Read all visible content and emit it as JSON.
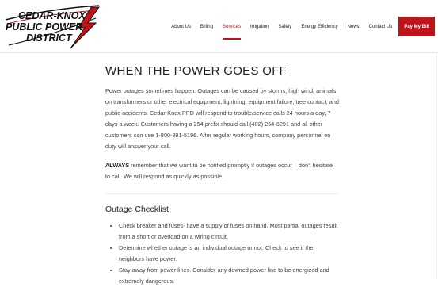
{
  "brand": {
    "logo_line1": "CEDAR-KNOX",
    "logo_line2": "PUBLIC POWER",
    "logo_line3": "DISTRICT",
    "primary_color": "#c0141b"
  },
  "nav": {
    "items": [
      {
        "label": "About Us"
      },
      {
        "label": "Billing"
      },
      {
        "label": "Services"
      },
      {
        "label": "Irrigation"
      },
      {
        "label": "Safety"
      },
      {
        "label": "Energy Efficiency"
      },
      {
        "label": "News"
      },
      {
        "label": "Contact Us"
      }
    ],
    "active": "Services",
    "pay_bill": "Pay My Bill"
  },
  "page": {
    "title": "WHEN THE POWER GOES OFF",
    "intro": "Power outages sometimes happen. Outages can be caused by storms, high wind, animals on transformers or other electrical equipment, lightning, equipment failure, tree contact, and public accidents. Cedar-Knox PPD will respond to trouble/service calls 24 hours a day, 7 days a week. Customers having a 254 prefix should call (402) 254-6291 and all other customers can use 1-800-891-5196. After regular working hours, company personnel on duty will answer your call.",
    "notice_bold": "ALWAYS",
    "notice_rest": " remember that we want to be notified promptly if outages occur – don't hesitate to call. We will respond as quickly as possible.",
    "checklist_title": "Outage Checklist",
    "checklist": [
      "Check breaker and fuses- have a supply of fuses on hand. Most partial outages result from a short or overload on a wiring circuit.",
      "Determine whether outage is an individual outage or not. Check to see if the neighbors have power.",
      "Stay away from power lines. Consider any downed power line to be energized and extremely dangerous."
    ]
  }
}
